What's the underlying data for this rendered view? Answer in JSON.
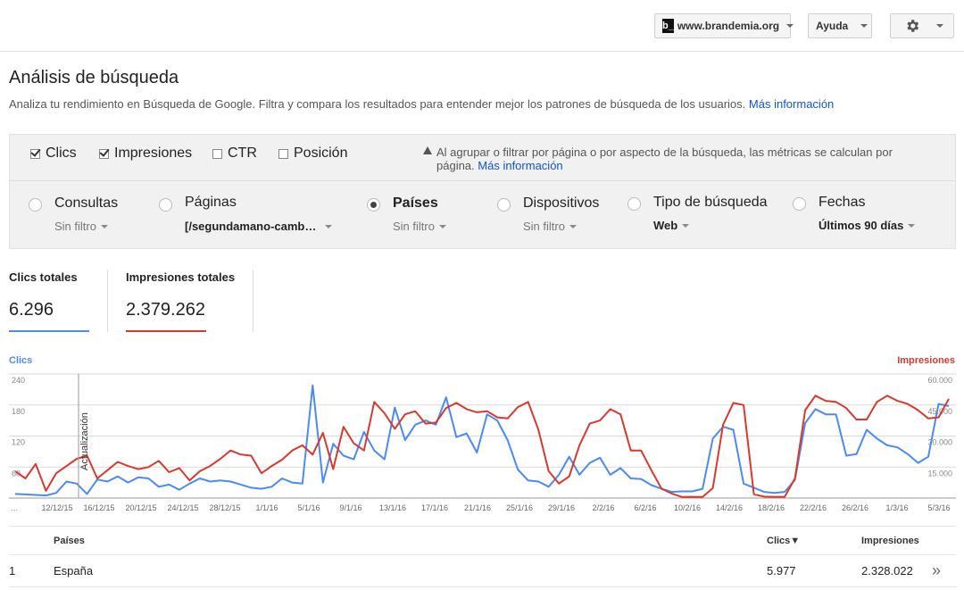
{
  "header": {
    "site_logo": "b_",
    "site_label": "www.brandemia.org",
    "help_label": "Ayuda",
    "settings_icon": "gear-icon"
  },
  "page": {
    "title": "Análisis de búsqueda",
    "description": "Analiza tu rendimiento en Búsqueda de Google. Filtra y compara los resultados para entender mejor los patrones de búsqueda de los usuarios.",
    "more_info": "Más información"
  },
  "metrics": {
    "clicks": {
      "label": "Clics",
      "checked": true
    },
    "impressions": {
      "label": "Impresiones",
      "checked": true
    },
    "ctr": {
      "label": "CTR",
      "checked": false
    },
    "position": {
      "label": "Posición",
      "checked": false
    },
    "warning_text": "Al agrupar o filtrar por página o por aspecto de la búsqueda, las métricas se calculan por página.",
    "warning_link": "Más información"
  },
  "dimensions": {
    "queries": {
      "label": "Consultas",
      "filter": "Sin filtro"
    },
    "pages": {
      "label": "Páginas",
      "filter": "[/segundamano-camb…"
    },
    "countries": {
      "label": "Países",
      "filter": "Sin filtro",
      "selected": true
    },
    "devices": {
      "label": "Dispositivos",
      "filter": "Sin filtro"
    },
    "search_type": {
      "label": "Tipo de búsqueda",
      "filter": "Web"
    },
    "dates": {
      "label": "Fechas",
      "filter": "Últimos 90 días"
    }
  },
  "totals": {
    "clicks_label": "Clics totales",
    "clicks_value": "6.296",
    "impressions_label": "Impresiones totales",
    "impressions_value": "2.379.262"
  },
  "colors": {
    "clicks": "#4a8af4",
    "impressions": "#d9392c"
  },
  "chart_data": {
    "type": "line",
    "left_axis_label": "Clics",
    "right_axis_label": "Impresiones",
    "left_ticks": [
      "240",
      "180",
      "120",
      "60"
    ],
    "right_ticks": [
      "60.000",
      "45.000",
      "30.000",
      "15.000"
    ],
    "left_ylim": [
      0,
      240
    ],
    "right_ylim": [
      0,
      60000
    ],
    "annotation": "Actualización",
    "x_labels": [
      "…",
      "12/12/15",
      "16/12/15",
      "20/12/15",
      "24/12/15",
      "28/12/15",
      "1/1/16",
      "5/1/16",
      "9/1/16",
      "13/1/16",
      "17/1/16",
      "21/1/16",
      "25/1/16",
      "29/1/16",
      "2/2/16",
      "6/2/16",
      "10/2/16",
      "14/2/16",
      "18/2/16",
      "22/2/16",
      "26/2/16",
      "1/3/16",
      "5/3/16"
    ],
    "series": [
      {
        "name": "Clics",
        "axis": "left",
        "values": [
          8,
          7,
          6,
          5,
          10,
          32,
          28,
          8,
          36,
          32,
          42,
          30,
          40,
          38,
          22,
          26,
          16,
          28,
          38,
          32,
          34,
          32,
          26,
          20,
          18,
          22,
          38,
          30,
          28,
          218,
          30,
          105,
          82,
          75,
          128,
          92,
          75,
          175,
          112,
          142,
          150,
          142,
          195,
          118,
          125,
          88,
          162,
          150,
          112,
          55,
          34,
          32,
          22,
          45,
          80,
          45,
          68,
          78,
          45,
          58,
          38,
          37,
          25,
          18,
          12,
          13,
          13,
          18,
          115,
          138,
          132,
          28,
          20,
          12,
          10,
          12,
          35,
          145,
          172,
          162,
          162,
          82,
          85,
          132,
          115,
          102,
          98,
          85,
          68,
          80,
          182,
          178
        ]
      },
      {
        "name": "Impresiones",
        "axis": "right",
        "values": [
          13000,
          9500,
          16500,
          3500,
          12000,
          15500,
          19000,
          20500,
          9500,
          13500,
          17500,
          15500,
          14000,
          15000,
          18000,
          12500,
          14500,
          8500,
          13000,
          15500,
          19000,
          23000,
          21000,
          20500,
          12000,
          15500,
          18500,
          23000,
          25500,
          21000,
          31500,
          14000,
          34500,
          26500,
          23000,
          46500,
          41000,
          33500,
          40500,
          42000,
          36000,
          36500,
          43500,
          46000,
          43000,
          41500,
          42000,
          39000,
          38500,
          44000,
          46500,
          33000,
          13000,
          7000,
          10500,
          25500,
          36000,
          37500,
          43000,
          40500,
          23000,
          23000,
          13500,
          4500,
          2200,
          500,
          600,
          500,
          4800,
          35500,
          46000,
          45000,
          1800,
          700,
          600,
          600,
          9500,
          42500,
          49500,
          47000,
          46500,
          43500,
          38000,
          38000,
          46500,
          49500,
          47000,
          45500,
          42500,
          38500,
          39000,
          48000
        ]
      }
    ]
  },
  "table": {
    "col_country": "Países",
    "col_clicks": "Clics▼",
    "col_impressions": "Impresiones",
    "rows": [
      {
        "rank": "1",
        "country": "España",
        "clicks": "5.977",
        "impressions": "2.328.022"
      }
    ]
  }
}
